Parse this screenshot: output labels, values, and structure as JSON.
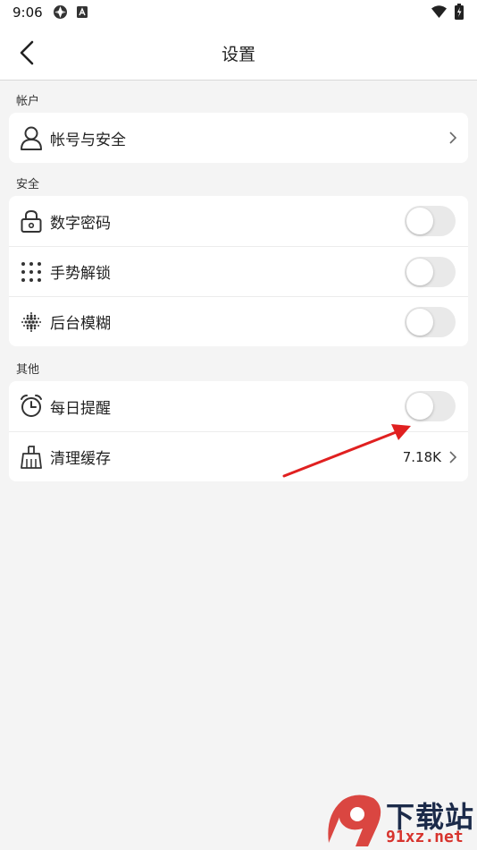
{
  "status_bar": {
    "time": "9:06"
  },
  "app_bar": {
    "title": "设置",
    "back_icon": "back-arrow-icon"
  },
  "sections": [
    {
      "label": "帐户",
      "items": [
        {
          "label": "帐号与安全",
          "icon": "user-icon",
          "control": "chevron"
        }
      ]
    },
    {
      "label": "安全",
      "items": [
        {
          "label": "数字密码",
          "icon": "lock-icon",
          "control": "toggle",
          "on": false
        },
        {
          "label": "手势解锁",
          "icon": "dot-grid-icon",
          "control": "toggle",
          "on": false
        },
        {
          "label": "后台模糊",
          "icon": "blur-icon",
          "control": "toggle",
          "on": false
        }
      ]
    },
    {
      "label": "其他",
      "items": [
        {
          "label": "每日提醒",
          "icon": "alarm-clock-icon",
          "control": "toggle",
          "on": false
        },
        {
          "label": "清理缓存",
          "icon": "broom-icon",
          "control": "chevron",
          "value": "7.18K"
        }
      ]
    }
  ],
  "annotation": {
    "arrow_color": "#e02020"
  },
  "watermark": {
    "top_text": "下载站",
    "bottom_text": "91xz.net",
    "colors": {
      "navy": "#1c2b4a",
      "red": "#d7332d"
    }
  }
}
